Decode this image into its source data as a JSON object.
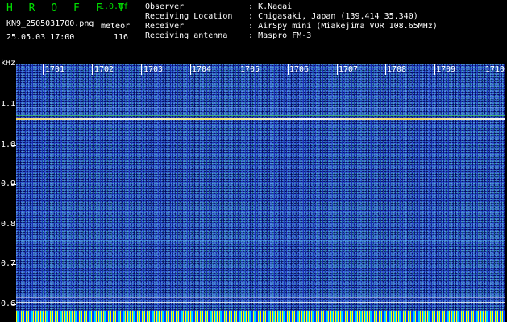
{
  "header": {
    "app_title": "H R O F F T",
    "version": "1.0.0f",
    "file_name": "KN9_2505031700.png",
    "mode": "meteor",
    "datetime": "25.05.03 17:00",
    "count": "116"
  },
  "info": [
    {
      "label": "Observer",
      "sep": ":",
      "value": "K.Nagai"
    },
    {
      "label": "Receiving Location",
      "sep": ":",
      "value": "Chigasaki, Japan (139.414 35.340)"
    },
    {
      "label": "Receiver",
      "sep": ":",
      "value": "AirSpy mini (Miakejima VOR 108.65MHz)"
    },
    {
      "label": "Receiving antenna",
      "sep": ":",
      "value": "Maspro FM-3"
    }
  ],
  "spectrogram": {
    "y_unit": "kHz",
    "y_ticks": [
      "1.1",
      "1.0",
      "0.9",
      "0.8",
      "0.7",
      "0.6"
    ],
    "x_ticks": [
      "1701",
      "1702",
      "1703",
      "1704",
      "1705",
      "1706",
      "1707",
      "1708",
      "1709",
      "1710"
    ],
    "colors": {
      "background": "#1a30b8",
      "carrier": "#ffee66",
      "text": "#ffffff",
      "title": "#00e000"
    }
  }
}
